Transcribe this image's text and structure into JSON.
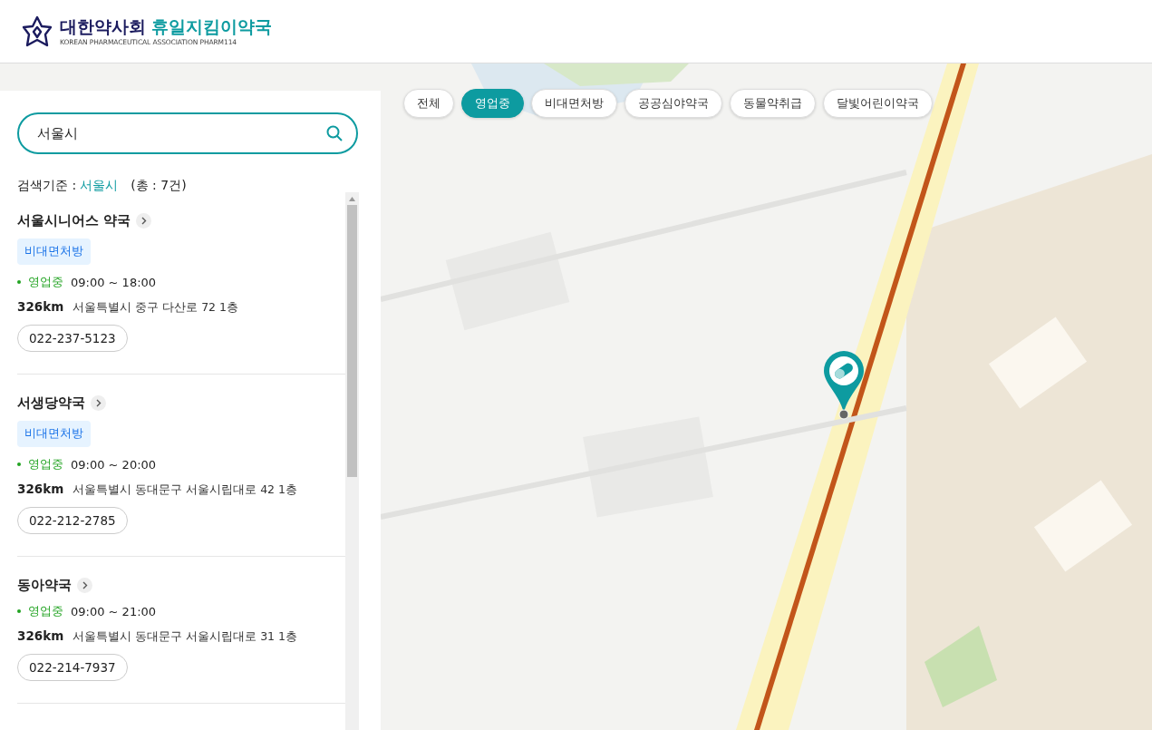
{
  "header": {
    "logo_title": "대한약사회",
    "logo_subtitle": "휴일지킴이약국",
    "logo_tagline": "KOREAN PHARMACEUTICAL ASSOCIATION PHARM114"
  },
  "search": {
    "value": "서울시"
  },
  "result_summary": {
    "label": "검색기준 :",
    "query": "서울시",
    "count": "(총 : 7건)"
  },
  "pharmacies": [
    {
      "name": "서울시니어스 약국",
      "tags": [
        "비대면처방"
      ],
      "status": "영업중",
      "hours": "09:00 ~ 18:00",
      "distance": "326km",
      "address": "서울특별시 중구 다산로 72 1층",
      "phone": "022-237-5123"
    },
    {
      "name": "서생당약국",
      "tags": [
        "비대면처방"
      ],
      "status": "영업중",
      "hours": "09:00 ~ 20:00",
      "distance": "326km",
      "address": "서울특별시 동대문구 서울시립대로 42 1층",
      "phone": "022-212-2785"
    },
    {
      "name": "동아약국",
      "status": "영업중",
      "hours": "09:00 ~ 21:00",
      "distance": "326km",
      "address": "서울특별시 동대문구 서울시립대로 31 1층",
      "phone": "022-214-7937"
    }
  ],
  "filters": [
    {
      "label": "전체",
      "selected": false
    },
    {
      "label": "영업중",
      "selected": true
    },
    {
      "label": "비대면처방",
      "selected": false
    },
    {
      "label": "공공심야약국",
      "selected": false
    },
    {
      "label": "동물약취급",
      "selected": false
    },
    {
      "label": "달빛어린이약국",
      "selected": false
    }
  ]
}
